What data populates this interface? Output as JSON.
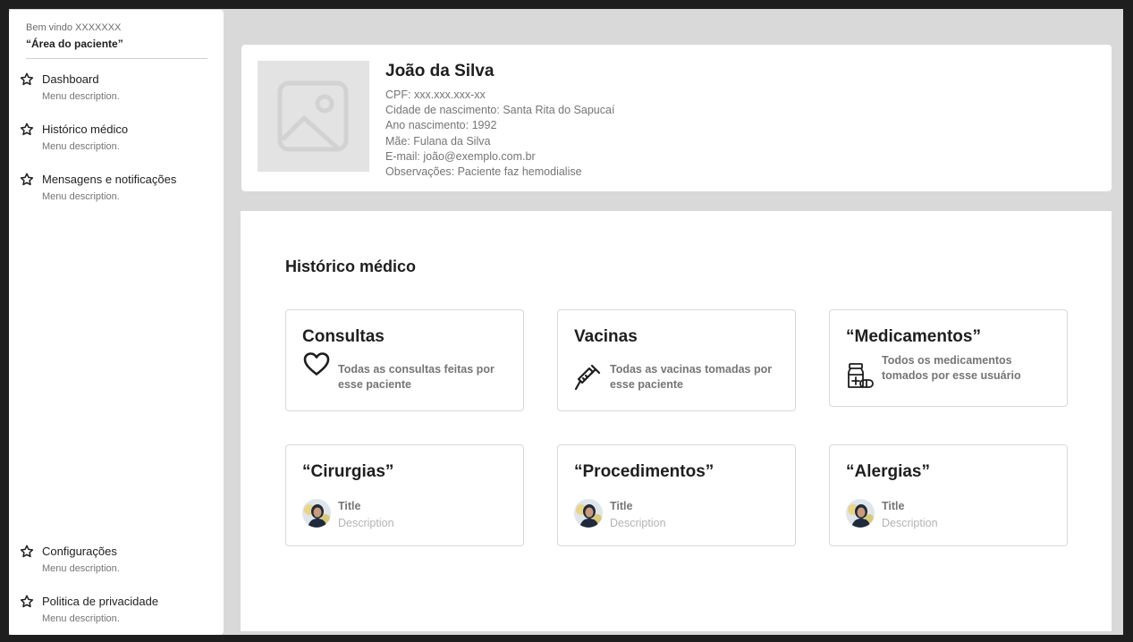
{
  "sidebar": {
    "welcome": "Bem vindo XXXXXXX",
    "area": "“Área do paciente”",
    "items": [
      {
        "label": "Dashboard",
        "description": "Menu description."
      },
      {
        "label": "Histórico médico",
        "description": "Menu description."
      },
      {
        "label": "Mensagens e notificações",
        "description": "Menu description."
      }
    ],
    "footer_items": [
      {
        "label": "Configurações",
        "description": "Menu description."
      },
      {
        "label": "Politica de privacidade",
        "description": "Menu description."
      }
    ]
  },
  "profile": {
    "name": "João da Silva",
    "lines": [
      "CPF: xxx.xxx.xxx-xx",
      "Cidade de nascimento: Santa Rita do Sapucaí",
      "Ano nascimento: 1992",
      "Mãe: Fulana da Silva",
      "E-mail: joão@exemplo.com.br",
      "Observações: Paciente faz hemodialise"
    ]
  },
  "history": {
    "title": "Histórico médico",
    "cards": [
      {
        "title": "Consultas",
        "icon": "heart-icon",
        "text": "Todas as consultas feitas por esse paciente"
      },
      {
        "title": "Vacinas",
        "icon": "syringe-icon",
        "text": "Todas as vacinas tomadas por esse paciente"
      },
      {
        "title": "“Medicamentos”",
        "icon": "medicine-icon",
        "text": "Todos os medicamentos tomados por esse usuário"
      },
      {
        "title": "“Cirurgias”",
        "icon": "avatar",
        "item_title": "Title",
        "item_description": "Description"
      },
      {
        "title": "“Procedimentos”",
        "icon": "avatar",
        "item_title": "Title",
        "item_description": "Description"
      },
      {
        "title": "“Alergias”",
        "icon": "avatar",
        "item_title": "Title",
        "item_description": "Description"
      }
    ]
  },
  "colors": {
    "background": "#d9d9d9",
    "frame": "#1e1e1e",
    "text_primary": "#1e1e1e",
    "text_secondary": "#757575",
    "text_muted": "#b3b3b3"
  }
}
